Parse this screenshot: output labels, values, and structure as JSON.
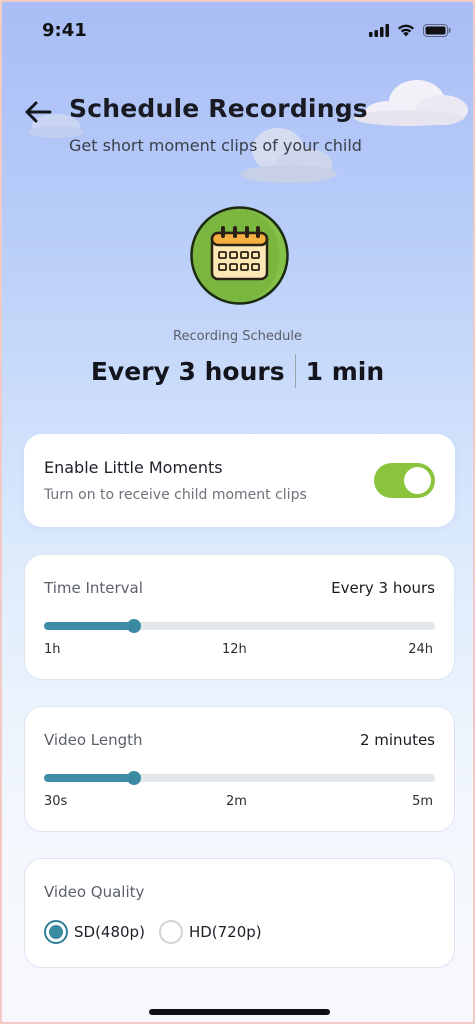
{
  "status_bar": {
    "time": "9:41",
    "icons": [
      "cellular-signal-icon",
      "wifi-icon",
      "battery-icon"
    ]
  },
  "header": {
    "back_icon": "arrow-left-icon",
    "title": "Schedule Recordings",
    "subtitle": "Get short moment clips of your child"
  },
  "schedule": {
    "icon": "calendar-icon",
    "caption": "Recording Schedule",
    "interval": "Every 3 hours",
    "length": "1 min"
  },
  "enable_card": {
    "title": "Enable Little Moments",
    "subtitle": "Turn on to receive child moment clips",
    "enabled": true
  },
  "time_interval": {
    "label": "Time Interval",
    "value": "Every 3 hours",
    "slider_fraction": 0.23,
    "ticks": [
      "1h",
      "12h",
      "24h"
    ]
  },
  "video_length": {
    "label": "Video Length",
    "value": "2 minutes",
    "slider_fraction": 0.23,
    "ticks": [
      "30s",
      "2m",
      "5m"
    ]
  },
  "video_quality": {
    "label": "Video Quality",
    "options": [
      "SD(480p)",
      "HD(720p)"
    ],
    "selected": "SD(480p)"
  },
  "colors": {
    "accent_green": "#8bc43c",
    "slider_teal": "#3f8ea6",
    "calendar_badge_green": "#7ab640"
  }
}
